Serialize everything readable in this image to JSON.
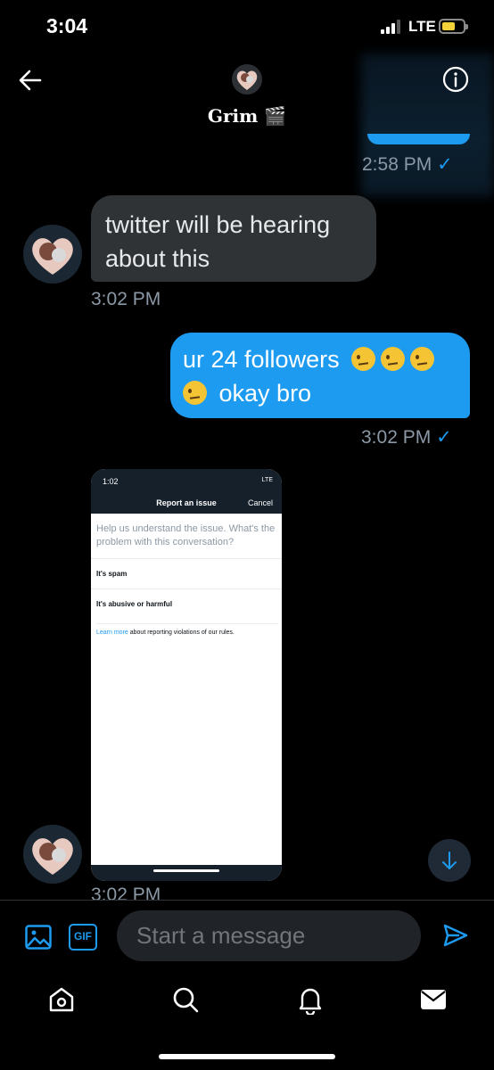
{
  "status_bar": {
    "time": "3:04",
    "network": "LTE"
  },
  "header": {
    "name": "Grim",
    "name_emoji": "🎬",
    "back_icon": "arrow-left-icon",
    "info_icon": "info-circle-icon"
  },
  "messages": [
    {
      "direction": "out",
      "time": "2:58 PM",
      "check": "✓"
    },
    {
      "direction": "in",
      "text": "twitter will be hearing about this",
      "time": "3:02 PM"
    },
    {
      "direction": "out",
      "text_line1": "ur 24 followers",
      "text_line2": "okay bro",
      "emoji": "face-with-raised-eyebrow",
      "emoji_count": 4,
      "time": "3:02 PM",
      "check": "✓"
    },
    {
      "direction": "in",
      "type": "image",
      "time": "3:02 PM"
    }
  ],
  "screenshot_image": {
    "time": "1:02",
    "network": "LTE",
    "title": "Report an issue",
    "cancel": "Cancel",
    "prompt": "Help us understand the issue. What's the problem with this conversation?",
    "options": [
      "It's spam",
      "It's abusive or harmful"
    ],
    "learn_more": "Learn more",
    "note": " about reporting violations of our rules."
  },
  "composer": {
    "placeholder": "Start a message",
    "gif_label": "GIF"
  },
  "tabs": [
    "home-icon",
    "search-icon",
    "notifications-icon",
    "messages-icon"
  ],
  "colors": {
    "accent": "#1d9bf0",
    "incoming_bubble": "#2f3336",
    "background": "#000000",
    "muted": "#8b98a5"
  }
}
